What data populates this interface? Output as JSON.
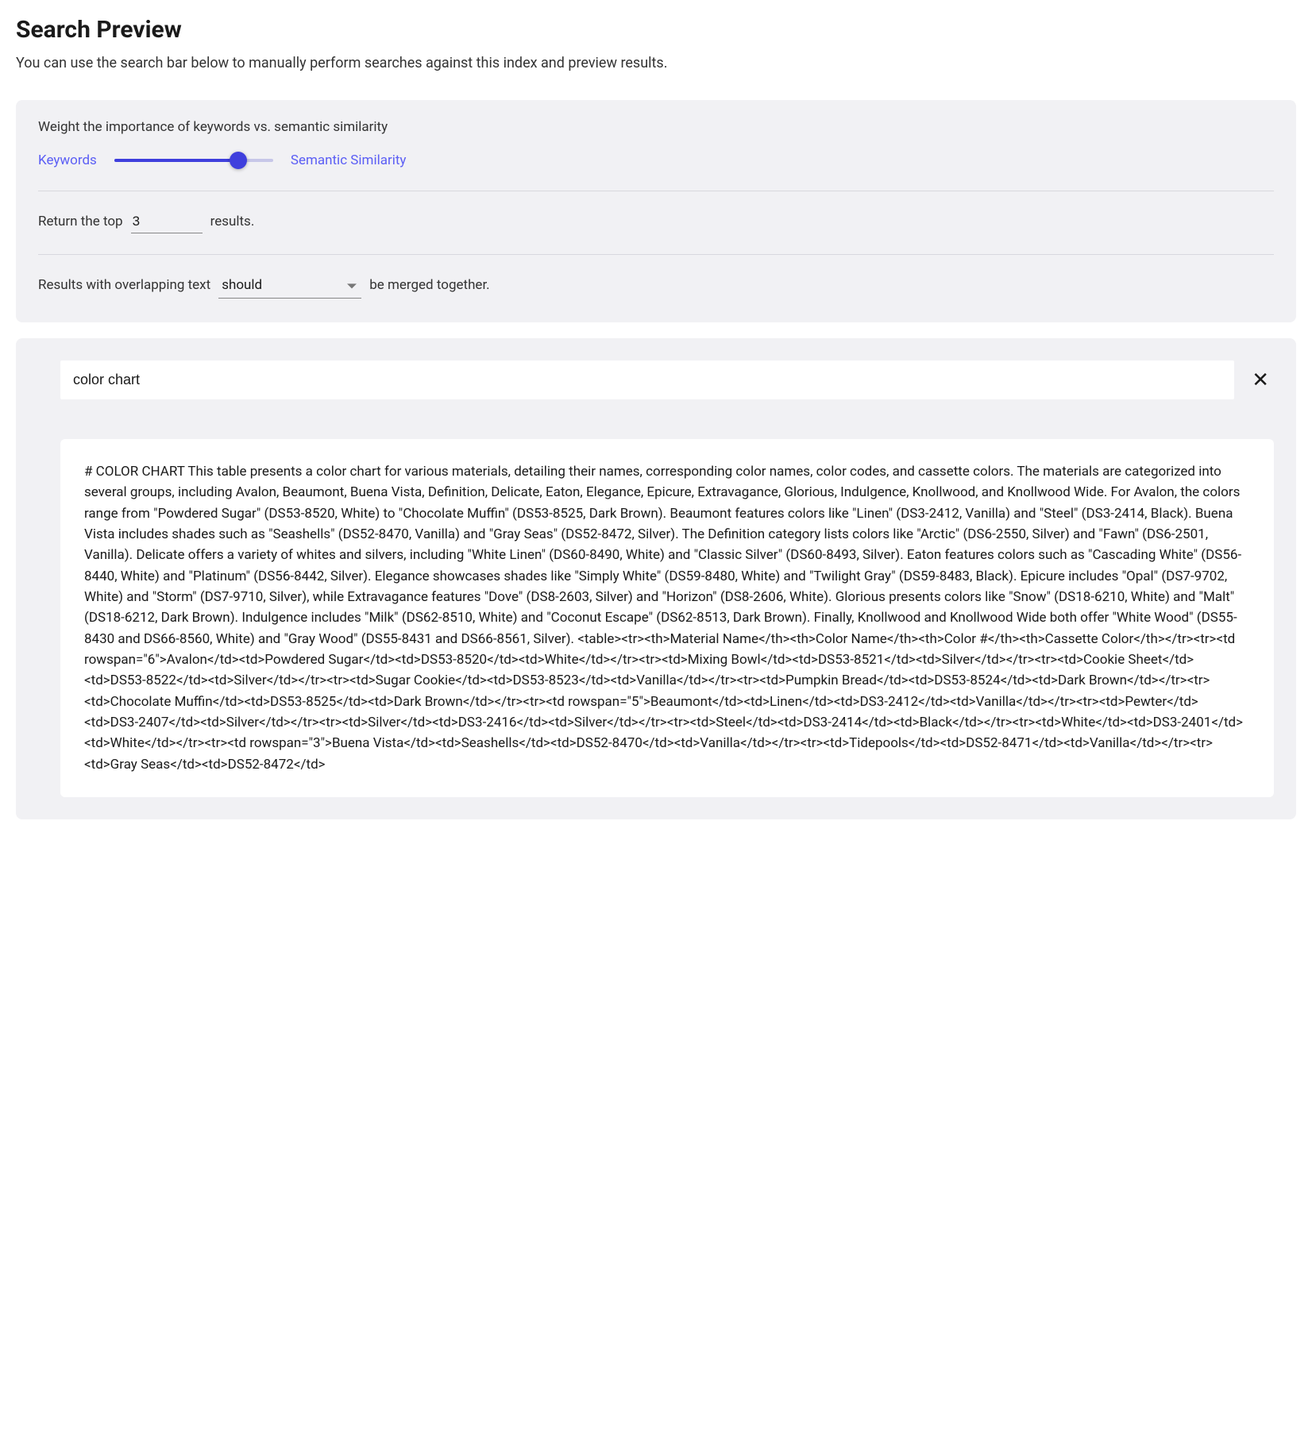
{
  "header": {
    "title": "Search Preview",
    "subtitle": "You can use the search bar below to manually perform searches against this index and preview results."
  },
  "settings": {
    "weight_label": "Weight the importance of keywords vs. semantic similarity",
    "slider_left": "Keywords",
    "slider_right": "Semantic Similarity",
    "top_prefix": "Return the top",
    "top_value": "3",
    "top_suffix": "results.",
    "merge_prefix": "Results with overlapping text",
    "merge_value": "should",
    "merge_suffix": "be merged together."
  },
  "search": {
    "query": "color chart"
  },
  "result": {
    "text": "# COLOR CHART This table presents a color chart for various materials, detailing their names, corresponding color names, color codes, and cassette colors. The materials are categorized into several groups, including Avalon, Beaumont, Buena Vista, Definition, Delicate, Eaton, Elegance, Epicure, Extravagance, Glorious, Indulgence, Knollwood, and Knollwood Wide. For Avalon, the colors range from \"Powdered Sugar\" (DS53-8520, White) to \"Chocolate Muffin\" (DS53-8525, Dark Brown). Beaumont features colors like \"Linen\" (DS3-2412, Vanilla) and \"Steel\" (DS3-2414, Black). Buena Vista includes shades such as \"Seashells\" (DS52-8470, Vanilla) and \"Gray Seas\" (DS52-8472, Silver). The Definition category lists colors like \"Arctic\" (DS6-2550, Silver) and \"Fawn\" (DS6-2501, Vanilla). Delicate offers a variety of whites and silvers, including \"White Linen\" (DS60-8490, White) and \"Classic Silver\" (DS60-8493, Silver). Eaton features colors such as \"Cascading White\" (DS56-8440, White) and \"Platinum\" (DS56-8442, Silver). Elegance showcases shades like \"Simply White\" (DS59-8480, White) and \"Twilight Gray\" (DS59-8483, Black). Epicure includes \"Opal\" (DS7-9702, White) and \"Storm\" (DS7-9710, Silver), while Extravagance features \"Dove\" (DS8-2603, Silver) and \"Horizon\" (DS8-2606, White). Glorious presents colors like \"Snow\" (DS18-6210, White) and \"Malt\" (DS18-6212, Dark Brown). Indulgence includes \"Milk\" (DS62-8510, White) and \"Coconut Escape\" (DS62-8513, Dark Brown). Finally, Knollwood and Knollwood Wide both offer \"White Wood\" (DS55-8430 and DS66-8560, White) and \"Gray Wood\" (DS55-8431 and DS66-8561, Silver). <table><tr><th>Material Name</th><th>Color Name</th><th>Color #</th><th>Cassette Color</th></tr><tr><td rowspan=\"6\">Avalon</td><td>Powdered Sugar</td><td>DS53-8520</td><td>White</td></tr><tr><td>Mixing Bowl</td><td>DS53-8521</td><td>Silver</td></tr><tr><td>Cookie Sheet</td><td>DS53-8522</td><td>Silver</td></tr><tr><td>Sugar Cookie</td><td>DS53-8523</td><td>Vanilla</td></tr><tr><td>Pumpkin Bread</td><td>DS53-8524</td><td>Dark Brown</td></tr><tr><td>Chocolate Muffin</td><td>DS53-8525</td><td>Dark Brown</td></tr><tr><td rowspan=\"5\">Beaumont</td><td>Linen</td><td>DS3-2412</td><td>Vanilla</td></tr><tr><td>Pewter</td><td>DS3-2407</td><td>Silver</td></tr><tr><td>Silver</td><td>DS3-2416</td><td>Silver</td></tr><tr><td>Steel</td><td>DS3-2414</td><td>Black</td></tr><tr><td>White</td><td>DS3-2401</td><td>White</td></tr><tr><td rowspan=\"3\">Buena Vista</td><td>Seashells</td><td>DS52-8470</td><td>Vanilla</td></tr><tr><td>Tidepools</td><td>DS52-8471</td><td>Vanilla</td></tr><tr><td>Gray Seas</td><td>DS52-8472</td>"
  }
}
